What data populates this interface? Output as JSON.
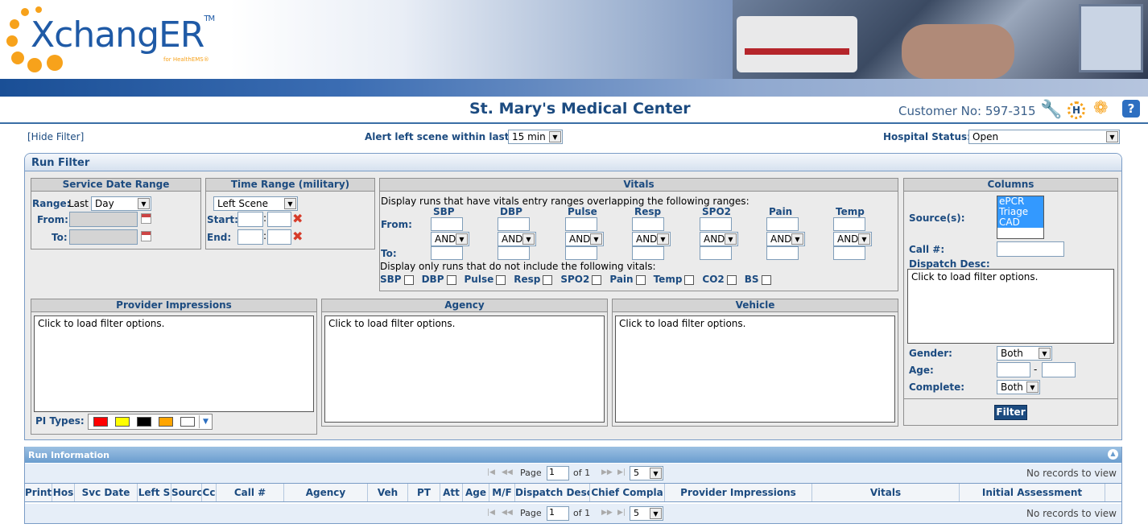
{
  "header": {
    "logo_text": "XchangER",
    "logo_tm": "TM",
    "logo_sub": "for HealthEMS®",
    "hospital_name": "St. Mary's Medical Center",
    "customer": "Customer No: 597-315",
    "icons": [
      "wrench-icon",
      "h-icon",
      "flower-icon",
      "help-icon"
    ],
    "h_letter": "H",
    "help_letter": "?"
  },
  "topbar": {
    "hide_filter": "[Hide Filter]",
    "alert_label": "Alert left scene within last:",
    "alert_value": "15 min",
    "status_label": "Hospital Status:",
    "status_value": "Open"
  },
  "run_filter": {
    "title": "Run Filter",
    "service_date": {
      "title": "Service Date Range",
      "range_label": "Range:",
      "last": "Last",
      "range_value": "Day",
      "from_label": "From:",
      "to_label": "To:"
    },
    "time_range": {
      "title": "Time Range (military)",
      "value": "Left Scene",
      "start_label": "Start:",
      "end_label": "End:",
      "colon": ":"
    },
    "vitals": {
      "title": "Vitals",
      "overlap_text": "Display runs that have vitals entry ranges overlapping the following ranges:",
      "from_label": "From:",
      "to_label": "To:",
      "columns": [
        "SBP",
        "DBP",
        "Pulse",
        "Resp",
        "SPO2",
        "Pain",
        "Temp"
      ],
      "and_value": "AND",
      "exclude_text": "Display only runs that do not include the following vitals:",
      "exclude_items": [
        "SBP",
        "DBP",
        "Pulse",
        "Resp",
        "SPO2",
        "Pain",
        "Temp",
        "CO2",
        "BS"
      ]
    },
    "columns": {
      "title": "Columns",
      "sources_label": "Source(s):",
      "sources": [
        "ePCR",
        "Triage",
        "CAD"
      ],
      "call_label": "Call #:",
      "dispatch_label": "Dispatch Desc:",
      "dispatch_placeholder": "Click to load filter options.",
      "gender_label": "Gender:",
      "gender_value": "Both",
      "age_label": "Age:",
      "age_dash": "-",
      "complete_label": "Complete:",
      "complete_value": "Both",
      "filter_button": "Filter"
    },
    "provider_impressions": {
      "title": "Provider Impressions",
      "placeholder": "Click to load filter options.",
      "pi_types_label": "PI Types:",
      "swatch_colors": [
        "#ff0000",
        "#ffff00",
        "#000000",
        "#ffa500",
        "#ffffff"
      ]
    },
    "agency": {
      "title": "Agency",
      "placeholder": "Click to load filter options."
    },
    "vehicle": {
      "title": "Vehicle",
      "placeholder": "Click to load filter options."
    }
  },
  "run_info": {
    "title": "Run Information",
    "page_label": "Page",
    "page_value": "1",
    "of_label": "of 1",
    "page_size": "5",
    "no_records": "No records to view",
    "columns": [
      "Print",
      "Hos",
      "Svc Date",
      "Left S",
      "Sourc",
      "Cc",
      "Call #",
      "Agency",
      "Veh",
      "PT",
      "Att",
      "Age",
      "M/F",
      "Dispatch Desc",
      "Chief Compla",
      "Provider Impressions",
      "Vitals",
      "Initial Assessment"
    ]
  }
}
